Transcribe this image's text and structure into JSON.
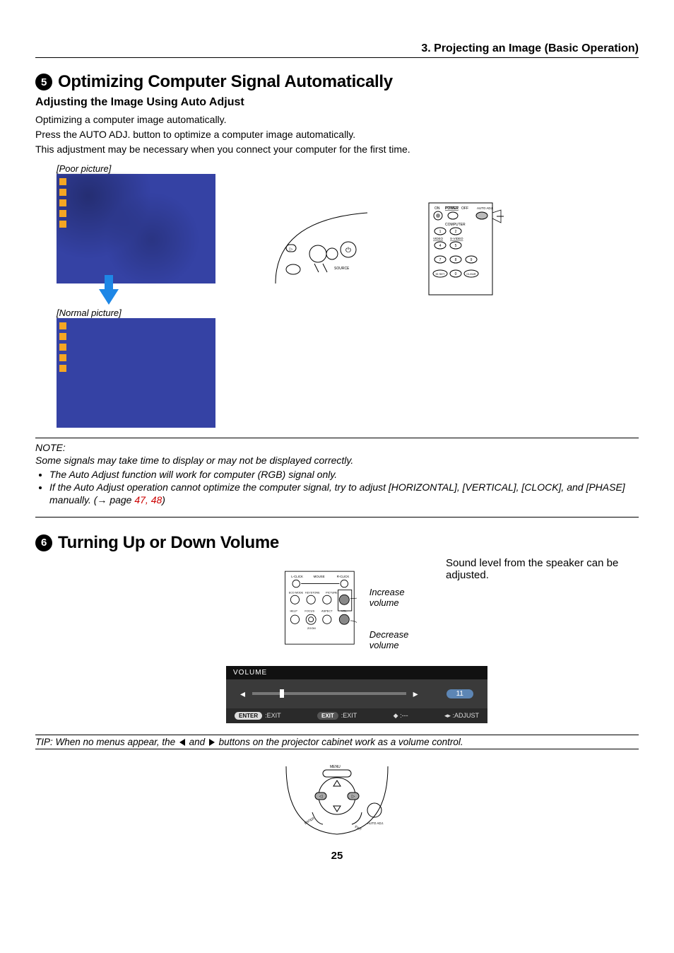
{
  "header": {
    "chapter": "3. Projecting an Image (Basic Operation)"
  },
  "section5": {
    "num": "5",
    "title": "Optimizing Computer Signal Automatically",
    "sub": "Adjusting the Image Using Auto Adjust",
    "p1": "Optimizing a computer image automatically.",
    "p2": "Press the AUTO ADJ. button to optimize a computer image automatically.",
    "p3": "This adjustment may be necessary when you connect your computer for the first time.",
    "cap_poor": "[Poor picture]",
    "cap_normal": "[Normal picture]",
    "note_label": "NOTE:",
    "note_line1": "Some signals may take time to display or may not be displayed correctly.",
    "bullet1": "The Auto Adjust function will work for computer  (RGB) signal only.",
    "bullet2_a": "If the Auto Adjust operation cannot optimize the computer signal, try to adjust [HORIZONTAL], [VERTICAL], [CLOCK], and [PHASE] manually. (→ page ",
    "bullet2_link": "47, 48",
    "bullet2_b": ")",
    "remote_labels": {
      "power_on": "ON",
      "power": "POWER",
      "power_off": "OFF",
      "auto_adj": "AUTO ADJ.",
      "computer": "COMPUTER",
      "video": "VIDEO",
      "svideo": "S-VIDEO",
      "idset": "ID SET",
      "clear": "CLEAR",
      "k1": "1",
      "k2": "2",
      "k4": "4",
      "k5": "5",
      "k7": "7",
      "k8": "8",
      "k9": "9",
      "k0": "0"
    },
    "proj_labels": {
      "source": "SOURCE"
    }
  },
  "section6": {
    "num": "6",
    "title": "Turning Up or Down Volume",
    "intro": "Sound level from the speaker can be adjusted.",
    "inc": "Increase volume",
    "dec": "Decrease volume",
    "remote_labels": {
      "lclick": "L-CLICK",
      "mouse": "MOUSE",
      "rclick": "R-CLICK",
      "eco": "ECO MODE",
      "keystone": "KEYSTONE",
      "picture": "PICTURE",
      "help": "HELP",
      "focus": "FOCUS",
      "aspect": "ASPECT",
      "vol": "VOL.",
      "zoom": "ZOOM"
    },
    "bar": {
      "title": "VOLUME",
      "value": "11",
      "enter": "ENTER",
      "exit1": ":EXIT",
      "exitb": "EXIT",
      "exit2": ":EXIT",
      "mid": ":---",
      "adjust": ":ADJUST"
    },
    "tip_a": "TIP: When no menus appear, the ",
    "tip_b": " and ",
    "tip_c": " buttons on the projector cabinet work as a volume control.",
    "cabinet_labels": {
      "menu": "MENU",
      "autoadj": "AUTO ADJ.",
      "enter": "ENTER",
      "exit": "EXIT"
    }
  },
  "page_number": "25"
}
